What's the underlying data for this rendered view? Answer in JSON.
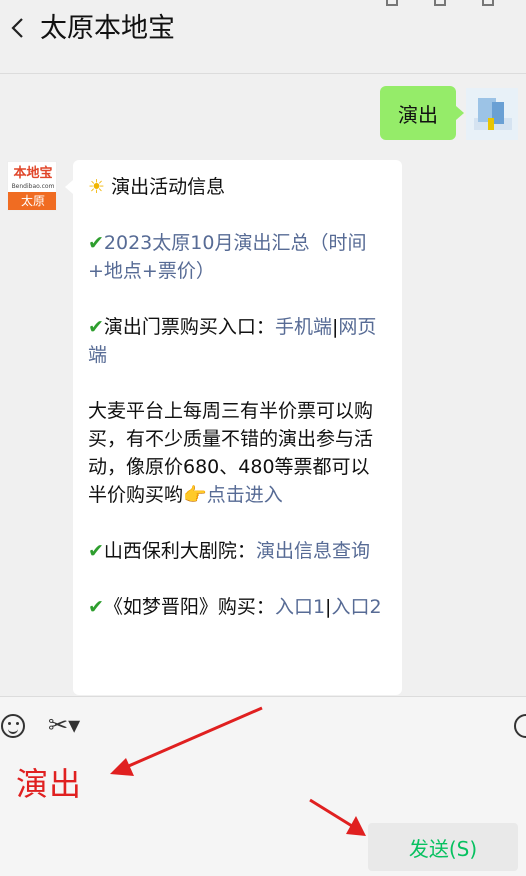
{
  "header": {
    "title": "太原本地宝",
    "back_icon": "chevron-left-icon"
  },
  "user_message": {
    "text": "演出"
  },
  "bot_avatar": {
    "logo_text": "本地宝",
    "url_text": "Bendibao.com",
    "city": "太原"
  },
  "bot_message": {
    "heading_icon": "☀",
    "heading": "演出活动信息",
    "check_icon": "✔",
    "pointing_icon": "👉",
    "item1": {
      "link": "2023太原10月演出汇总（时间+地点+票价）"
    },
    "item2": {
      "prefix": "演出门票购买入口：",
      "link1": "手机端",
      "sep": "|",
      "link2": "网页端"
    },
    "item3": {
      "text": "大麦平台上每周三有半价票可以购买，有不少质量不错的演出参与活动，像原价680、480等票都可以半价购买哟",
      "link": "点击进入"
    },
    "item4": {
      "prefix": "山西保利大剧院：",
      "link": "演出信息查询"
    },
    "item5": {
      "prefix": "《如梦晋阳》购买：",
      "link1": "入口1",
      "sep": "|",
      "link2": "入口2"
    }
  },
  "input": {
    "value": "演出"
  },
  "toolbar": {
    "emoji_icon": "emoji-icon",
    "scissors_icon": "scissors-icon",
    "send_label": "发送(S)"
  },
  "colors": {
    "user_bubble": "#95ec69",
    "link": "#576b95",
    "annotation_red": "#e02020",
    "send_text": "#07c160"
  }
}
